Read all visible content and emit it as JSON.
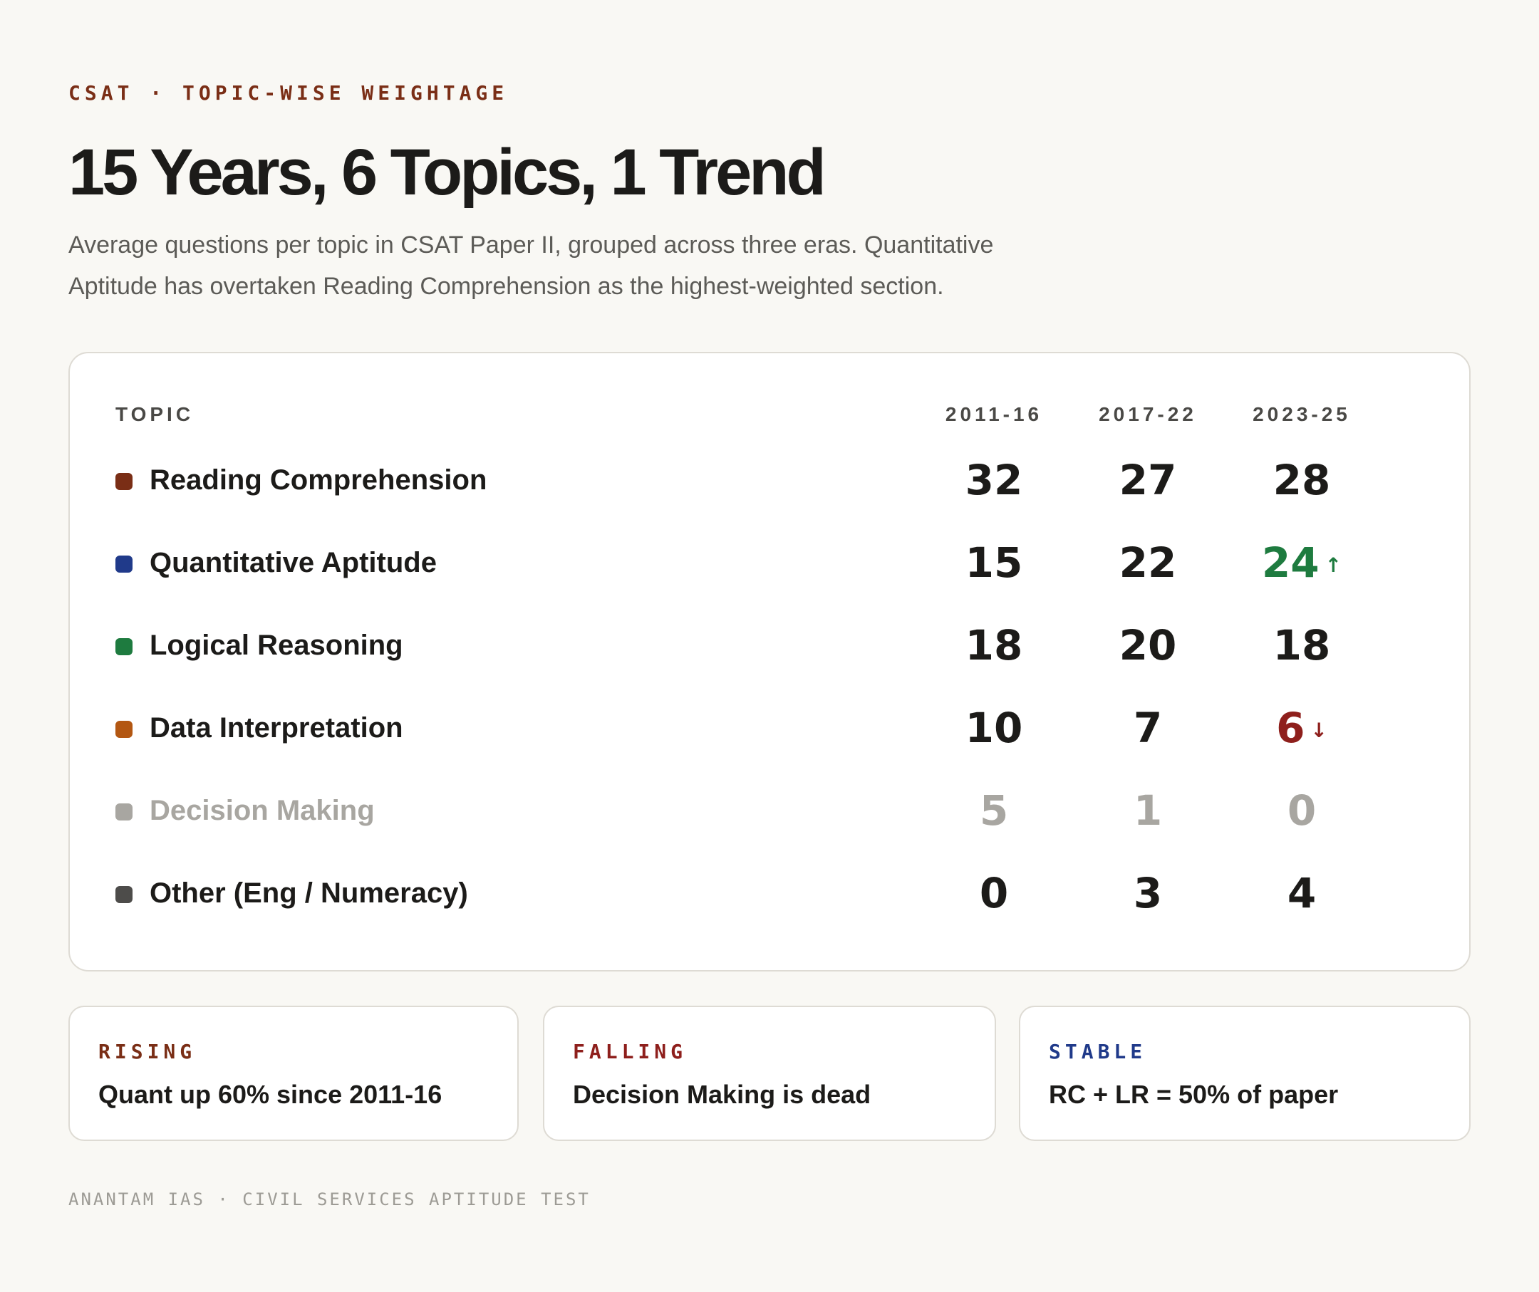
{
  "eyebrow": "CSAT · TOPIC-WISE WEIGHTAGE",
  "title": "15 Years, 6 Topics, 1 Trend",
  "subtitle": "Average questions per topic in CSAT Paper II, grouped across three eras. Quantitative Aptitude has overtaken Reading Comprehension as the highest-weighted section.",
  "chart_data": {
    "type": "table",
    "title": "15 Years, 6 Topics, 1 Trend",
    "topic_header": "TOPIC",
    "columns": [
      "2011-16",
      "2017-22",
      "2023-25"
    ],
    "rows": [
      {
        "name": "Reading Comprehension",
        "color": "#7a2e16",
        "values": [
          32,
          27,
          28
        ],
        "trend": "",
        "muted": false
      },
      {
        "name": "Quantitative Aptitude",
        "color": "#203a8a",
        "values": [
          15,
          22,
          24
        ],
        "trend": "up",
        "muted": false
      },
      {
        "name": "Logical Reasoning",
        "color": "#1e7b3f",
        "values": [
          18,
          20,
          18
        ],
        "trend": "",
        "muted": false
      },
      {
        "name": "Data Interpretation",
        "color": "#b35712",
        "values": [
          10,
          7,
          6
        ],
        "trend": "down",
        "muted": false
      },
      {
        "name": "Decision Making",
        "color": "#a8a6a1",
        "values": [
          5,
          1,
          0
        ],
        "trend": "",
        "muted": true
      },
      {
        "name": "Other (Eng / Numeracy)",
        "color": "#4d4c4a",
        "values": [
          0,
          3,
          4
        ],
        "trend": "",
        "muted": false
      }
    ]
  },
  "icons": {
    "up": "arrow-up-icon",
    "down": "arrow-down-icon"
  },
  "colors": {
    "rise": "#1e7b3f",
    "fall": "#8e1f1c"
  },
  "cards": [
    {
      "tag": "RISING",
      "tag_color": "#7a2e16",
      "text": "Quant up 60% since 2011-16"
    },
    {
      "tag": "FALLING",
      "tag_color": "#8e1f1c",
      "text": "Decision Making is dead"
    },
    {
      "tag": "STABLE",
      "tag_color": "#203a8a",
      "text": "RC + LR = 50% of paper"
    }
  ],
  "footer": "ANANTAM IAS · CIVIL SERVICES APTITUDE TEST"
}
